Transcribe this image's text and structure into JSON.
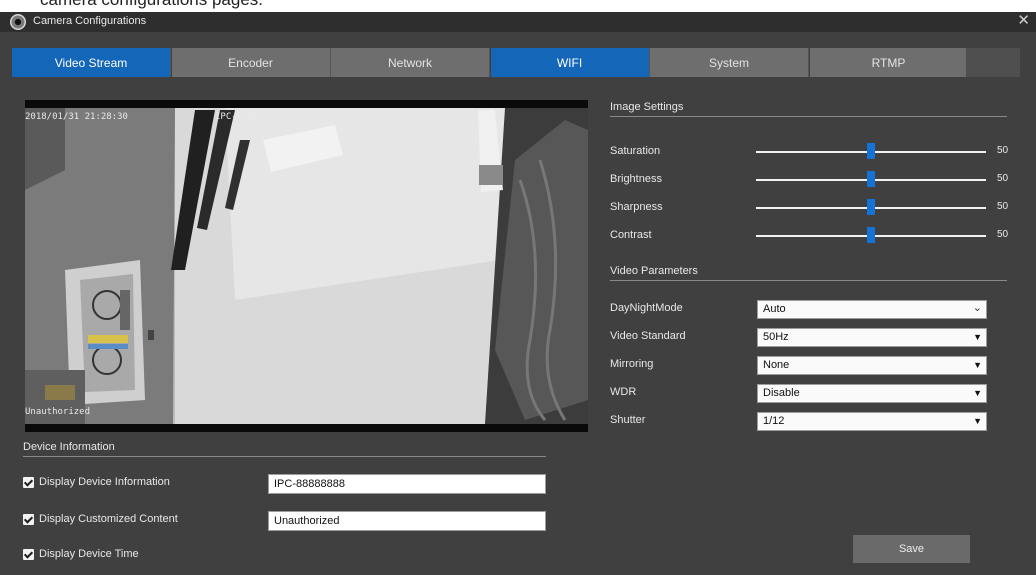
{
  "caption": "camera configurations pages.",
  "window": {
    "title": "Camera Configurations",
    "close_glyph": "✕"
  },
  "tabs": [
    {
      "label": "Video Stream",
      "style": "blue"
    },
    {
      "label": "Encoder",
      "style": "gray"
    },
    {
      "label": "Network",
      "style": "gray"
    },
    {
      "label": "WIFI",
      "style": "blue"
    },
    {
      "label": "System",
      "style": "gray"
    },
    {
      "label": "RTMP",
      "style": "gray"
    }
  ],
  "video": {
    "osd_time": "2018/01/31 21:28:30",
    "osd_name": "IPC-88888888",
    "osd_custom": "Unauthorized"
  },
  "device_info": {
    "title": "Device Information",
    "display_device_info": {
      "label": "Display Device Information",
      "checked": true,
      "value": "IPC-88888888"
    },
    "display_custom_content": {
      "label": "Display Customized Content",
      "checked": true,
      "value": "Unauthorized"
    },
    "display_device_time": {
      "label": "Display Device Time",
      "checked": true
    }
  },
  "image_settings": {
    "title": "Image Settings",
    "sliders": [
      {
        "label": "Saturation",
        "value": 50,
        "fraction": 0.5
      },
      {
        "label": "Brightness",
        "value": 50,
        "fraction": 0.5
      },
      {
        "label": "Sharpness",
        "value": 50,
        "fraction": 0.5
      },
      {
        "label": "Contrast",
        "value": 50,
        "fraction": 0.5
      }
    ]
  },
  "video_parameters": {
    "title": "Video Parameters",
    "day_night_mode": {
      "label": "DayNightMode",
      "value": "Auto"
    },
    "video_standard": {
      "label": "Video Standard",
      "value": "50Hz"
    },
    "mirroring": {
      "label": "Mirroring",
      "value": "None"
    },
    "wdr": {
      "label": "WDR",
      "value": "Disable"
    },
    "shutter": {
      "label": "Shutter",
      "value": "1/12"
    }
  },
  "save_label": "Save",
  "colors": {
    "window_bg": "#404040",
    "accent_blue": "#1466b8",
    "slider_thumb": "#1573d6"
  }
}
